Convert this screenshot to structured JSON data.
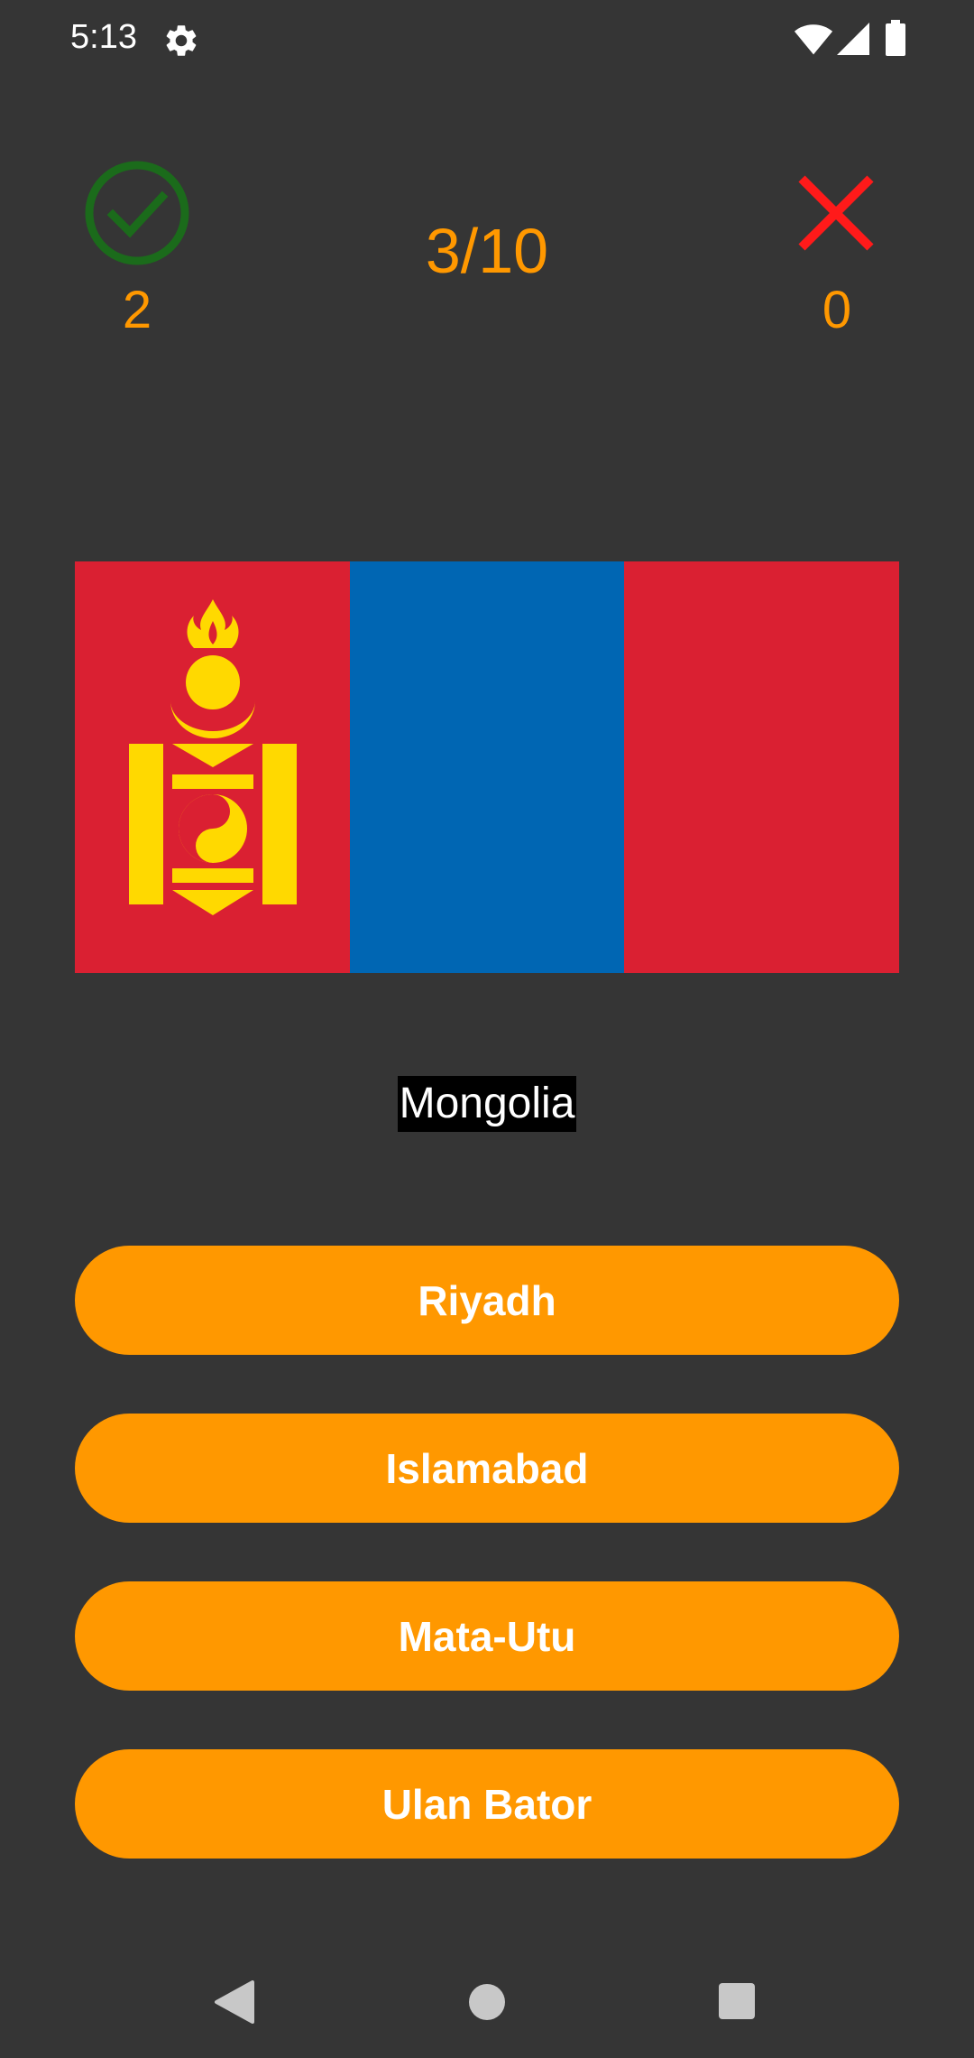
{
  "status_bar": {
    "time": "5:13",
    "icons": [
      "gear-icon",
      "wifi-icon",
      "signal-icon",
      "battery-icon"
    ]
  },
  "score": {
    "correct_icon": "check-circle-icon",
    "correct_count": "2",
    "progress": "3/10",
    "wrong_icon": "close-icon",
    "wrong_count": "0"
  },
  "flag": {
    "country": "Mongolia",
    "colors": {
      "red": "#da2032",
      "blue": "#0066b3",
      "gold": "#ffd900"
    }
  },
  "answers": [
    {
      "label": "Riyadh"
    },
    {
      "label": "Islamabad"
    },
    {
      "label": "Mata-Utu"
    },
    {
      "label": "Ulan Bator"
    }
  ],
  "nav_bar": {
    "icons": [
      "back-icon",
      "home-icon",
      "recents-icon"
    ]
  },
  "theme": {
    "background": "#353535",
    "accent": "#ff9800",
    "correct": "#1b6b1b",
    "wrong": "#ff1a1a"
  }
}
